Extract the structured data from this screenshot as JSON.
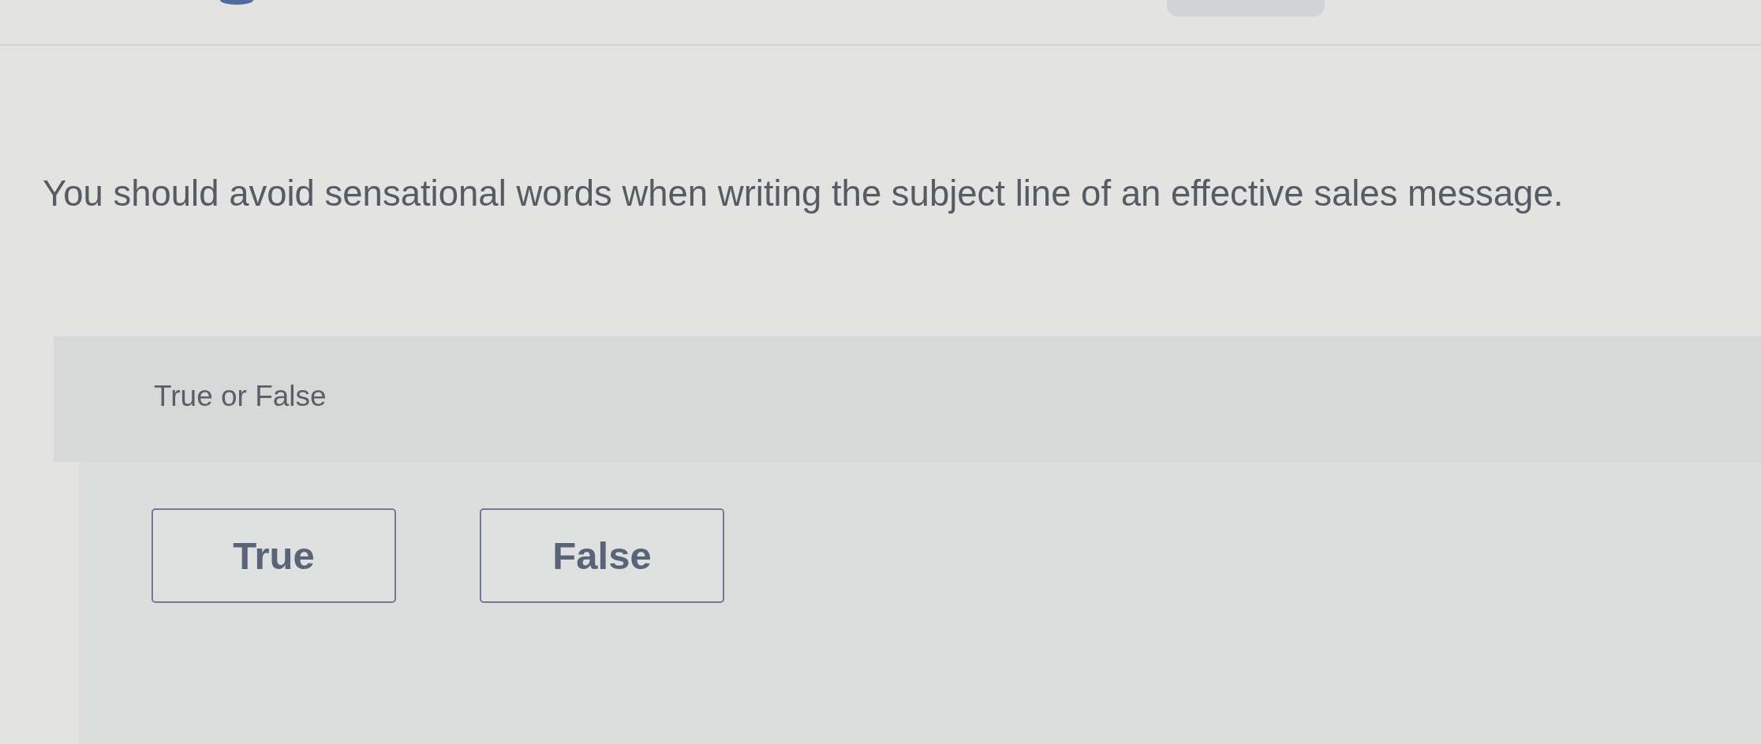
{
  "question": {
    "text": "You should avoid sensational words when writing the subject line of an effective sales message."
  },
  "answer_panel": {
    "prompt": "True or False",
    "options": [
      {
        "label": "True",
        "selected": false
      },
      {
        "label": "False",
        "selected": false
      }
    ]
  }
}
